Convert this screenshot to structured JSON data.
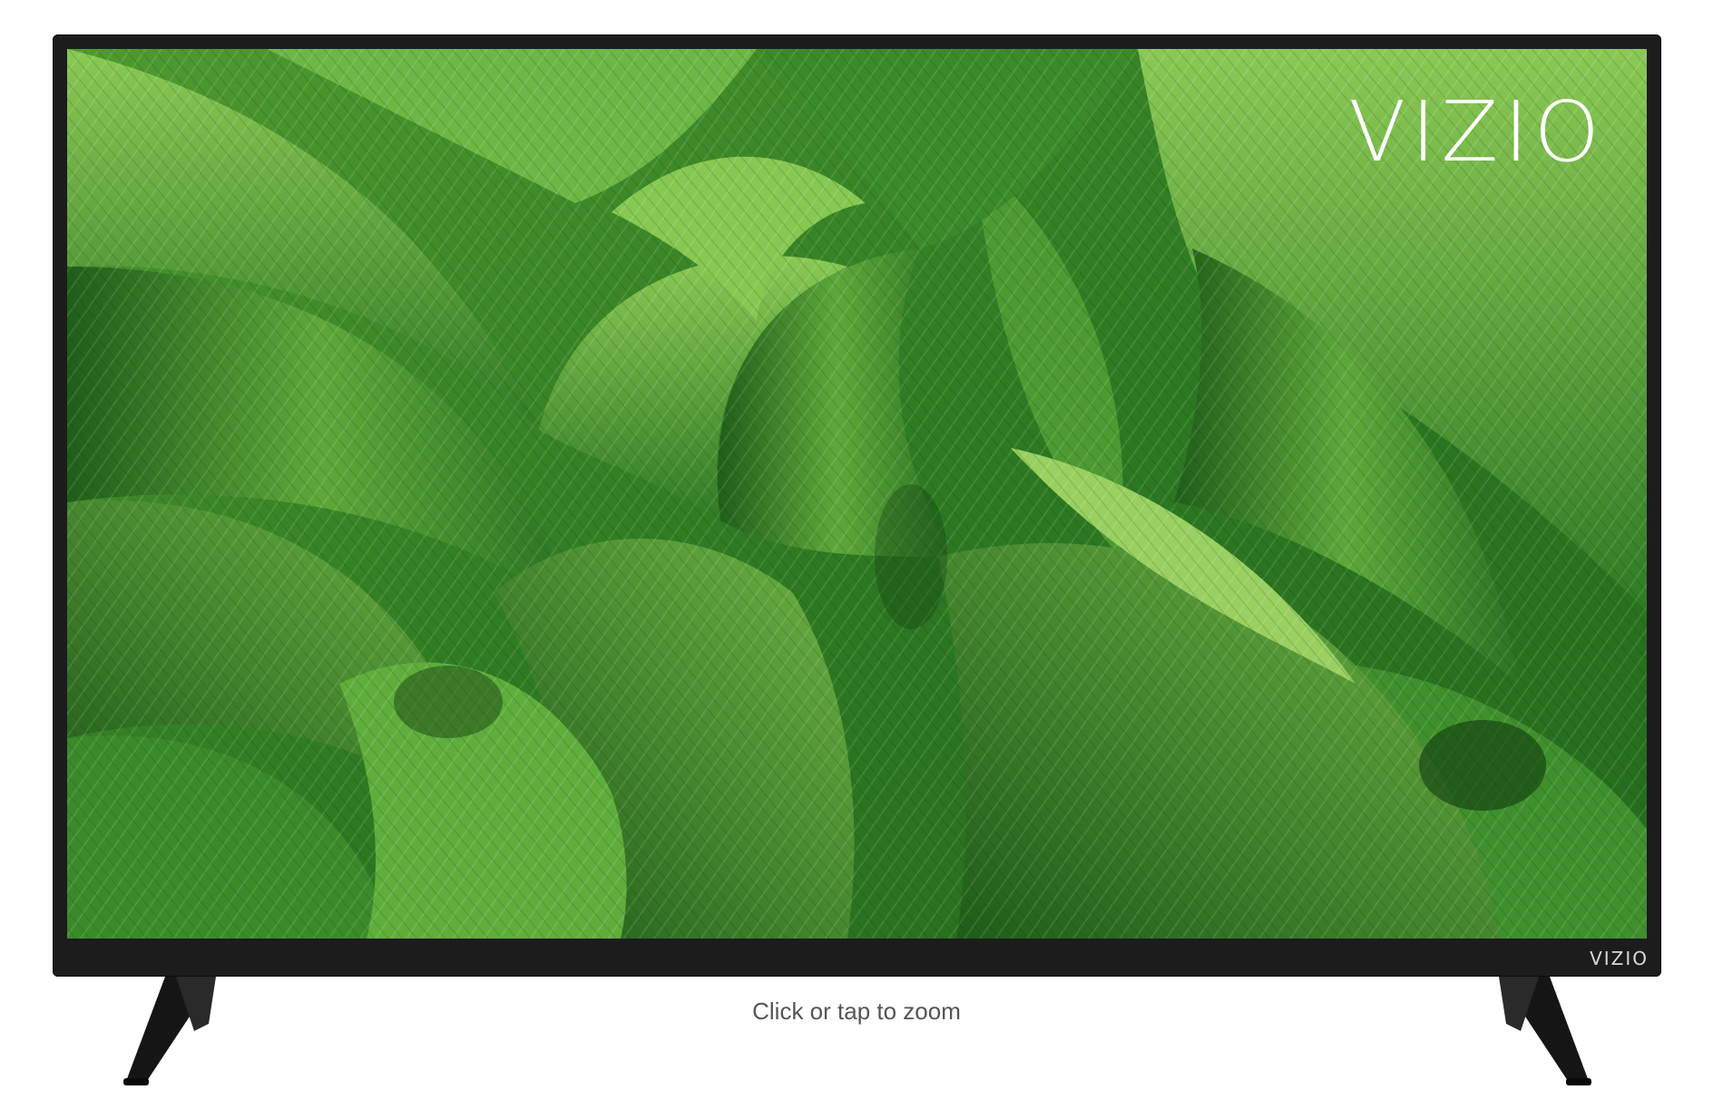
{
  "product": {
    "brand": "VIZIO",
    "bezel_brand": "VIZIO",
    "zoom_hint": "Click or tap to zoom"
  },
  "colors": {
    "frame": "#1c1c1c",
    "screen_base": "#2f7a25",
    "leaf_light": "#7cc04a",
    "leaf_dark": "#1d5a18",
    "hint_text": "#555555"
  }
}
